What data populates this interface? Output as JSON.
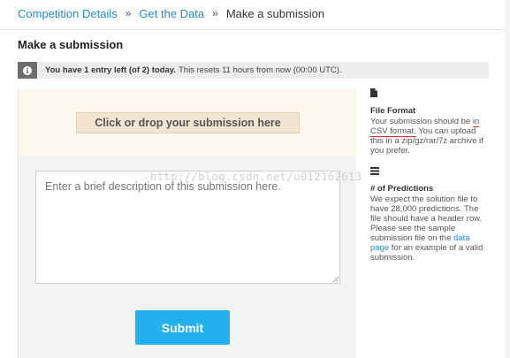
{
  "breadcrumb": {
    "items": [
      "Competition Details",
      "Get the Data"
    ],
    "separator": "»",
    "current": "Make a submission"
  },
  "page_title": "Make a submission",
  "notice": {
    "icon": "info-icon",
    "bold": "You have 1 entry left (of 2) today.",
    "rest": "This resets 11 hours from now (00:00 UTC)."
  },
  "upload": {
    "drop_label": "Click or drop your submission here",
    "description_placeholder": "Enter a brief description of this submission here.",
    "submit_label": "Submit"
  },
  "sidebar": {
    "file_format": {
      "icon": "document-icon",
      "title": "File Format",
      "text_pre": "Your submission should be",
      "csv_text": "in CSV format.",
      "text_post": "You can upload this in a zip/gz/rar/7z archive if you prefer."
    },
    "predictions": {
      "icon": "list-icon",
      "title": "# of Predictions",
      "text_pre": "We expect the solution file to have 28,000 predictions. The file should have a header row. Please see the sample submission file on the",
      "link": "data page",
      "text_post": "for an example of a valid submission."
    }
  },
  "watermark": "http://blog.csdn.net/u012162613",
  "colors": {
    "link": "#1d8ec9",
    "submit": "#22b1ee",
    "dropzone": "#fdf8ee",
    "annotation_underline": "#d9302c"
  }
}
